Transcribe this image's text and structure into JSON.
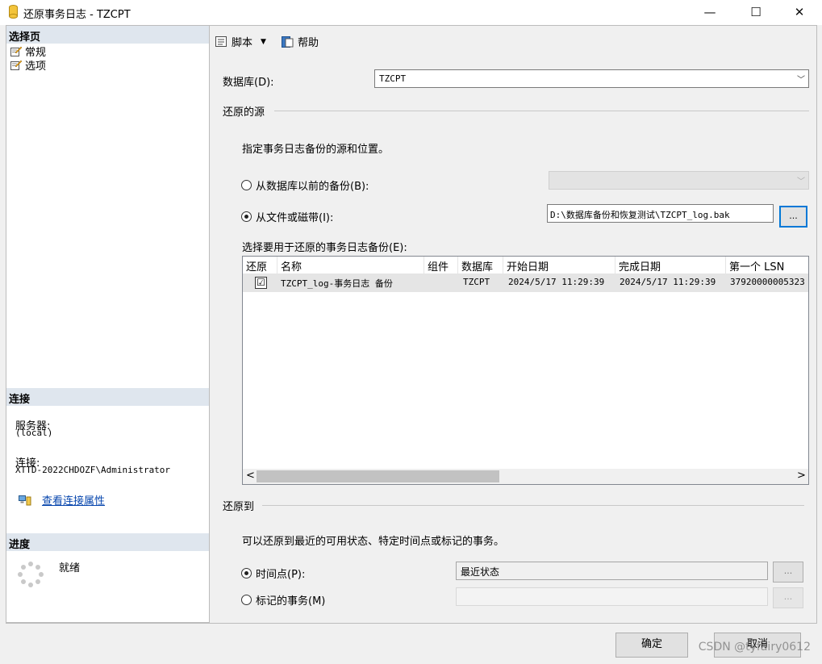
{
  "window": {
    "title": "还原事务日志 - TZCPT",
    "minimize": "—",
    "maximize": "☐",
    "close": "✕"
  },
  "left": {
    "select_page_header": "选择页",
    "pages": [
      {
        "label": "常规"
      },
      {
        "label": "选项"
      }
    ],
    "connection_header": "连接",
    "server_label": "服务器:",
    "server_value": "(local)",
    "connection_label": "连接:",
    "connection_value": "XTTD-2022CHDOZF\\Administrator",
    "view_props_link": "查看连接属性",
    "progress_header": "进度",
    "progress_status": "就绪"
  },
  "toolbar": {
    "script_label": "脚本",
    "help_label": "帮助"
  },
  "database": {
    "label": "数据库(D):",
    "value": "TZCPT"
  },
  "restore_source": {
    "group_label": "还原的源",
    "description": "指定事务日志备份的源和位置。",
    "from_previous_label": "从数据库以前的备份(B):",
    "from_file_label": "从文件或磁带(I):",
    "file_path": "D:\\数据库备份和恢复测试\\TZCPT_log.bak",
    "browse_label": "...",
    "select_backup_label": "选择要用于还原的事务日志备份(E):"
  },
  "grid": {
    "columns": [
      "还原",
      "名称",
      "组件",
      "数据库",
      "开始日期",
      "完成日期",
      "第一个 LSN"
    ],
    "rows": [
      {
        "checked": "☑",
        "name": "TZCPT_log-事务日志  备份",
        "component": "",
        "database": "TZCPT",
        "start_date": "2024/5/17 11:29:39",
        "finish_date": "2024/5/17 11:29:39",
        "first_lsn": "37920000005323"
      }
    ],
    "scroll_left": "<",
    "scroll_right": ">"
  },
  "restore_to": {
    "group_label": "还原到",
    "description": "可以还原到最近的可用状态、特定时间点或标记的事务。",
    "point_in_time_label": "时间点(P):",
    "point_in_time_value": "最近状态",
    "marked_tx_label": "标记的事务(M)",
    "ellipsis": "..."
  },
  "buttons": {
    "ok": "确定",
    "cancel": "取消"
  },
  "watermark": "CSDN @tyfairy0612",
  "colors": {
    "section_header_bg": "#dfe6ee",
    "grid_row_bg": "#e5e5e5",
    "link": "#0645ad",
    "browse_border": "#0078d7"
  }
}
